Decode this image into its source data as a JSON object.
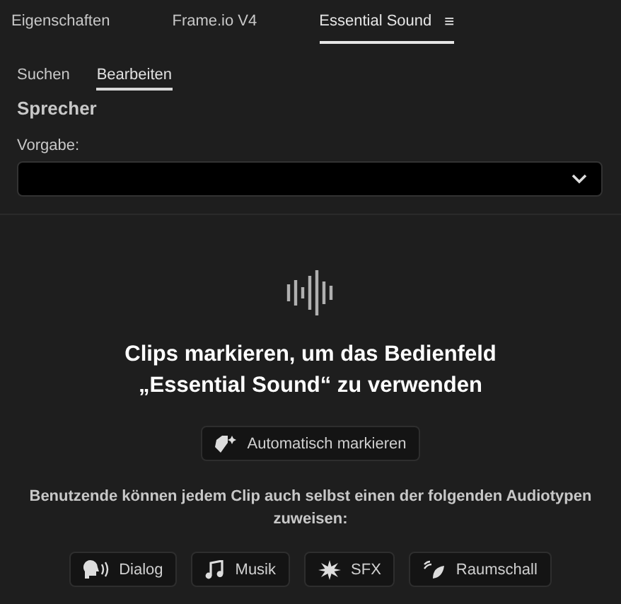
{
  "panel_tabs": [
    {
      "label": "Eigenschaften",
      "selected": false
    },
    {
      "label": "Frame.io V4",
      "selected": false
    },
    {
      "label": "Essential Sound",
      "selected": true,
      "menu": "≡"
    }
  ],
  "sub_tabs": [
    {
      "label": "Suchen",
      "selected": false
    },
    {
      "label": "Bearbeiten",
      "selected": true
    }
  ],
  "section_title": "Sprecher",
  "preset": {
    "label": "Vorgabe:"
  },
  "empty_state": {
    "heading": "Clips markieren, um das Bedienfeld „Essential Sound“ zu verwenden",
    "auto_button": "Automatisch markieren",
    "hint": "Benutzende können jedem Clip auch selbst einen der folgenden Audiotypen zuweisen:",
    "audio_types": [
      {
        "kind": "dialog",
        "label": "Dialog"
      },
      {
        "kind": "music",
        "label": "Musik"
      },
      {
        "kind": "sfx",
        "label": "SFX"
      },
      {
        "kind": "ambience",
        "label": "Raumschall"
      }
    ]
  }
}
